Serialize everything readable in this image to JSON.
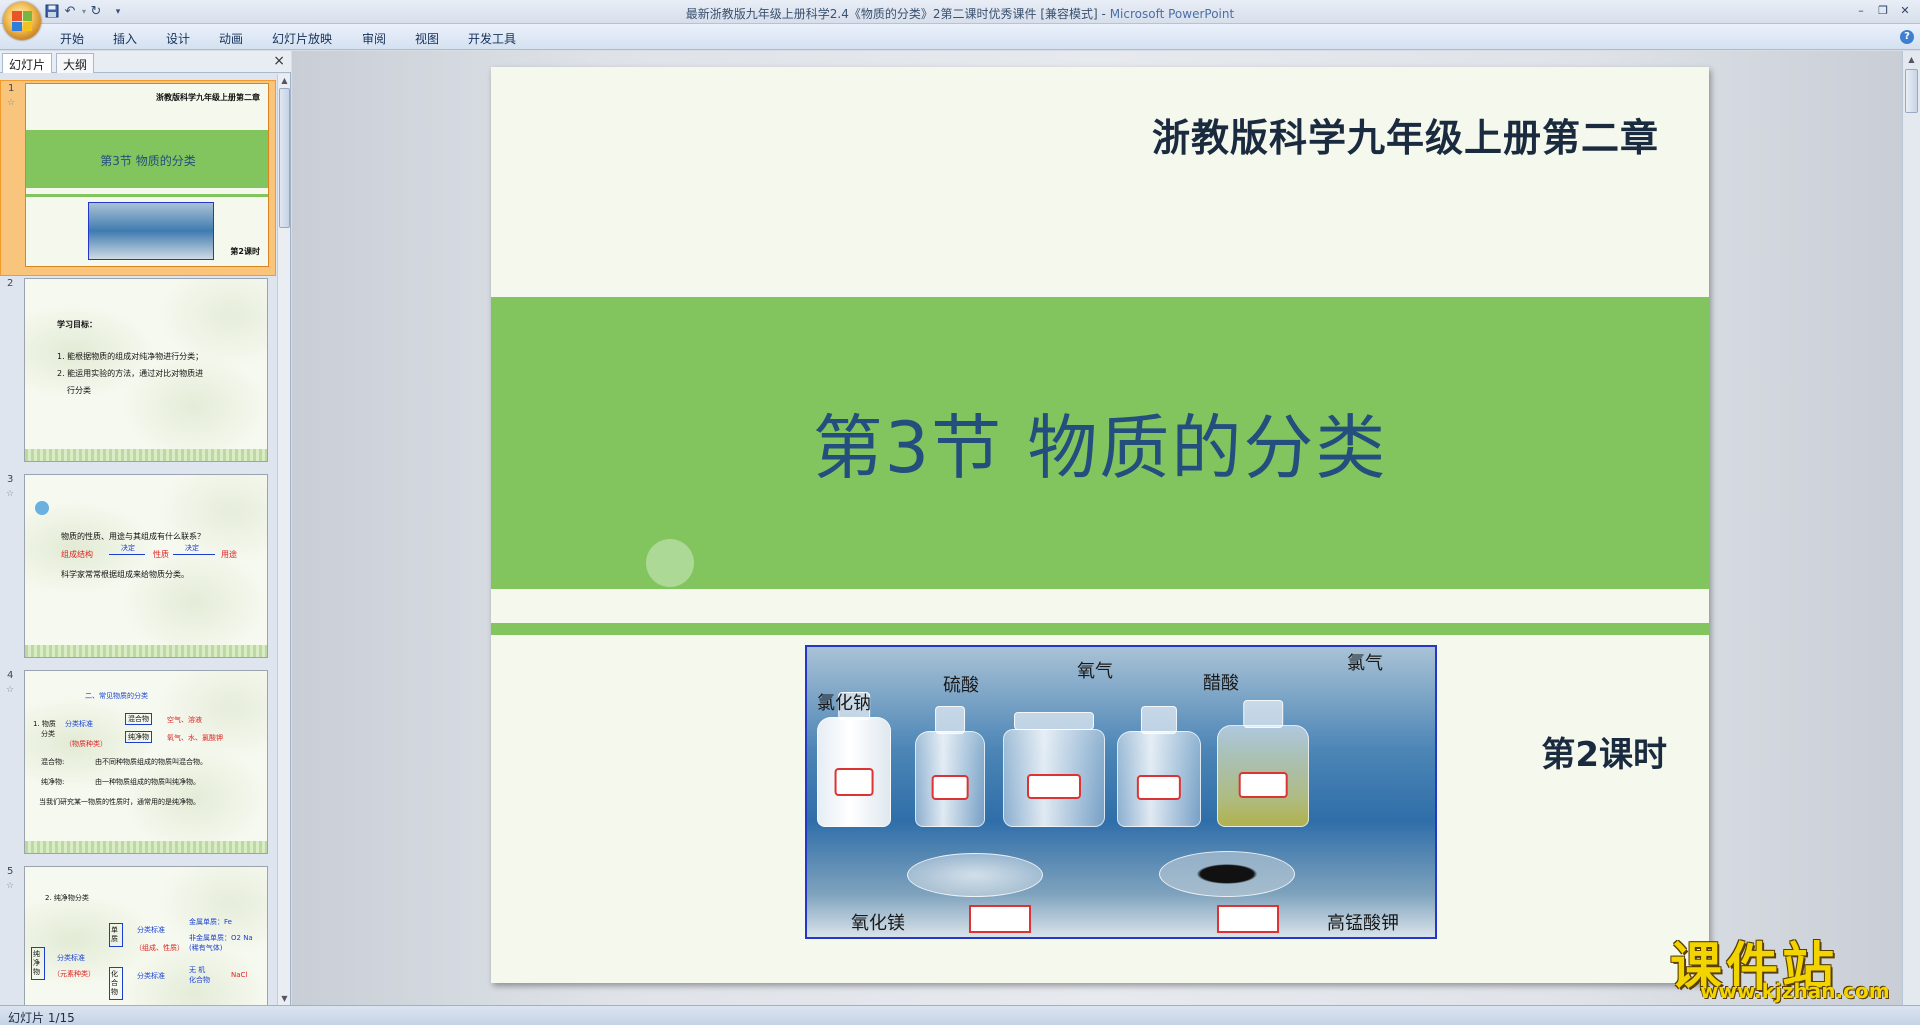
{
  "window": {
    "title": "最新浙教版九年级上册科学2.4《物质的分类》2第二课时优秀课件 [兼容模式]",
    "app_name": "Microsoft PowerPoint"
  },
  "ribbon": {
    "tabs": [
      "开始",
      "插入",
      "设计",
      "动画",
      "幻灯片放映",
      "审阅",
      "视图",
      "开发工具"
    ]
  },
  "pane": {
    "tabs": [
      "幻灯片",
      "大纲"
    ],
    "close": "×"
  },
  "thumbnails": [
    {
      "num": "1",
      "header": "浙教版科学九年级上册第二章",
      "title": "第3节  物质的分类",
      "footer": "第2课时"
    },
    {
      "num": "2",
      "heading": "学习目标：",
      "lines": [
        "1. 能根据物质的组成对纯净物进行分类；",
        "2. 能运用实验的方法，通过对比对物质进",
        "行分类"
      ]
    },
    {
      "num": "3",
      "lines": [
        "物质的性质、用途与其组成有什么联系？",
        "组成结构",
        "决定",
        "性质",
        "决定",
        "用途",
        "科学家常常根据组成来给物质分类。"
      ]
    },
    {
      "num": "4",
      "lines": [
        "二、常见物质的分类",
        "1. 物质",
        "分类",
        "分类标准",
        "（物质种类）",
        "混合物",
        "纯净物",
        "空气、溶液",
        "氧气、水、氯酸钾",
        "混合物:",
        "由不同种物质组成的物质叫混合物。",
        "纯净物:",
        "由一种物质组成的物质叫纯净物。",
        "当我们研究某一物质的性质时，通常用的是纯净物。"
      ]
    },
    {
      "num": "5",
      "lines": [
        "2. 纯净物分类",
        "纯净物",
        "分类标准",
        "（元素种类）",
        "单质",
        "化合物",
        "分类标准",
        "（组成、性质）",
        "分类标准",
        "金属单质：Fe",
        "非金属单质：O2  Na",
        "(稀有气体)",
        "无    机",
        "化合物",
        "NaCl"
      ]
    }
  ],
  "slide": {
    "header": "浙教版科学九年级上册第二章",
    "title": "第3节  物质的分类",
    "photo_labels": [
      "氯化钠",
      "硫酸",
      "氧气",
      "醋酸",
      "氯气",
      "氧化镁",
      "高锰酸钾"
    ],
    "period": "第2课时"
  },
  "status": {
    "slide_indicator": "幻灯片 1/15"
  },
  "watermark": {
    "cn": "课件站",
    "url": "www.kjzhan.com"
  },
  "colors": {
    "band_green": "#82c55f",
    "title_blue": "#234e7d",
    "dark_text": "#1a2a3f",
    "selection_orange": "#f9c57d"
  }
}
